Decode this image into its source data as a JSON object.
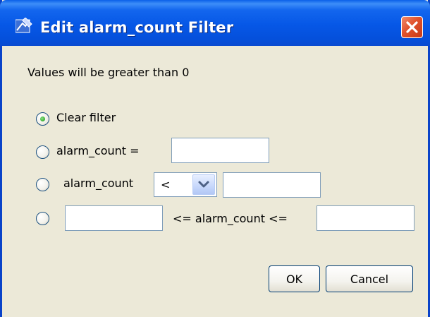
{
  "dialog": {
    "title": "Edit alarm_count Filter",
    "app_icon": "edit-filter-icon",
    "close_icon": "close-icon"
  },
  "info_text": "Values will be greater than 0",
  "options": {
    "clear": {
      "label": "Clear filter",
      "selected": true
    },
    "equals": {
      "label": "alarm_count =",
      "value": "",
      "selected": false
    },
    "compare": {
      "label": "alarm_count",
      "operator": "<",
      "value": "",
      "selected": false
    },
    "range": {
      "between_label": "<= alarm_count <=",
      "min_value": "",
      "max_value": "",
      "selected": false
    }
  },
  "buttons": {
    "ok": "OK",
    "cancel": "Cancel"
  },
  "colors": {
    "titlebar": "#0a5fe8",
    "frame": "#0a43c9",
    "dialog_bg": "#ece9d8",
    "close_button": "#e0512c",
    "radio_selected": "#3fb33a"
  }
}
